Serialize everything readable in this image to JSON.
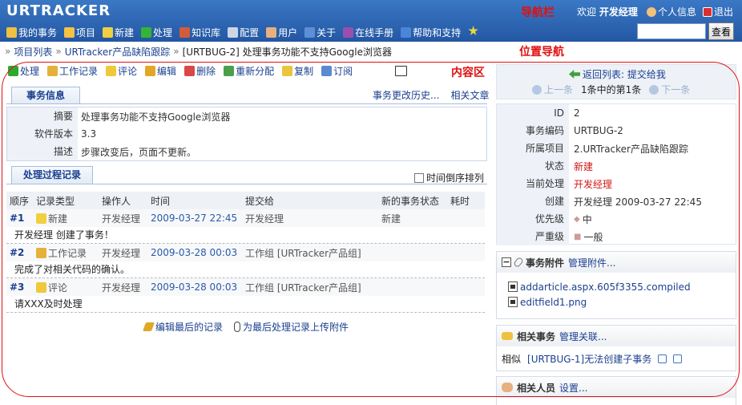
{
  "header": {
    "logo": "URTRACKER",
    "nav_annotation": "导航栏",
    "welcome_prefix": "欢迎",
    "user_name": "开发经理",
    "profile": "个人信息",
    "logout": "退出",
    "search_button": "查看",
    "search_value": ""
  },
  "menu": [
    {
      "label": "我的事务",
      "icon": "home-icon",
      "color": "#f0c040"
    },
    {
      "label": "项目",
      "icon": "database-icon",
      "color": "#f5c242"
    },
    {
      "label": "新建",
      "icon": "new-icon",
      "color": "#f0d040"
    },
    {
      "label": "处理",
      "icon": "check-icon",
      "color": "#34b534"
    },
    {
      "label": "知识库",
      "icon": "books-icon",
      "color": "#d35c3a"
    },
    {
      "label": "配置",
      "icon": "gear-icon",
      "color": "#cfd6e3"
    },
    {
      "label": "用户",
      "icon": "users-icon",
      "color": "#e6b080"
    },
    {
      "label": "关于",
      "icon": "info-icon",
      "color": "#5d8fd8"
    },
    {
      "label": "在线手册",
      "icon": "book-icon",
      "color": "#9a4fb0"
    },
    {
      "label": "帮助和支持",
      "icon": "help-icon",
      "color": "#4b86d6"
    }
  ],
  "breadcrumb": {
    "items": [
      "项目列表",
      "URTracker产品缺陷跟踪"
    ],
    "current": "[URTBUG-2] 处理事务功能不支持Google浏览器",
    "annotation": "位置导航"
  },
  "toolbar": {
    "items": [
      {
        "label": "处理",
        "icon": "check-icon",
        "color": "#2fa82f"
      },
      {
        "label": "工作记录",
        "icon": "notes-icon",
        "color": "#e5b13a"
      },
      {
        "label": "评论",
        "icon": "comment-icon",
        "color": "#f0c83c"
      },
      {
        "label": "编辑",
        "icon": "pencil-icon",
        "color": "#e0a826"
      },
      {
        "label": "删除",
        "icon": "delete-icon",
        "color": "#d94747"
      },
      {
        "label": "重新分配",
        "icon": "reassign-icon",
        "color": "#4aa04a"
      },
      {
        "label": "复制",
        "icon": "copy-icon",
        "color": "#e9c43e"
      },
      {
        "label": "订阅",
        "icon": "mail-icon",
        "color": "#5a8ad0"
      }
    ],
    "content_annotation": "内容区"
  },
  "tabs": {
    "info": "事务信息",
    "history": "事务更改历史...",
    "related": "相关文章",
    "records": "处理过程记录",
    "reverse": "时间倒序排列"
  },
  "info": [
    {
      "key": "摘要",
      "value": "处理事务功能不支持Google浏览器"
    },
    {
      "key": "软件版本",
      "value": "3.3"
    },
    {
      "key": "描述",
      "value": "步骤改变后，页面不更新。"
    }
  ],
  "records": {
    "columns": [
      "顺序",
      "记录类型",
      "操作人",
      "时间",
      "提交给",
      "新的事务状态",
      "耗时"
    ],
    "rows": [
      {
        "seq": "#1",
        "type": "新建",
        "icon": "new-icon",
        "color": "#f0d040",
        "operator": "开发经理",
        "time": "2009-03-27 22:45",
        "to": "开发经理",
        "status": "新建",
        "cost": "",
        "desc": "开发经理 创建了事务！"
      },
      {
        "seq": "#2",
        "type": "工作记录",
        "icon": "notes-icon",
        "color": "#e5b13a",
        "operator": "开发经理",
        "time": "2009-03-28 00:03",
        "to": "工作组 [URTracker产品组]",
        "status": "",
        "cost": "",
        "desc": "完成了对相关代码的确认。"
      },
      {
        "seq": "#3",
        "type": "评论",
        "icon": "comment-icon",
        "color": "#f0c83c",
        "operator": "开发经理",
        "time": "2009-03-28 00:03",
        "to": "工作组 [URTracker产品组]",
        "status": "",
        "cost": "",
        "desc": "请XXX及时处理"
      }
    ],
    "edit_last": "编辑最后的记录",
    "upload": "为最后处理记录上传附件"
  },
  "nav": {
    "back": "返回列表: 提交给我",
    "prev": "上一条",
    "position": "1条中的第1条",
    "next": "下一条"
  },
  "props": [
    {
      "key": "ID",
      "value": "2"
    },
    {
      "key": "事务编码",
      "value": "URTBUG-2"
    },
    {
      "key": "所属项目",
      "value": "2.URTracker产品缺陷跟踪"
    },
    {
      "key": "状态",
      "value": "新建",
      "red": true
    },
    {
      "key": "当前处理",
      "value": "开发经理",
      "red": true
    },
    {
      "key": "创建",
      "value": "开发经理  2009-03-27 22:45"
    },
    {
      "key": "优先级",
      "value": "中",
      "marker": "◆"
    },
    {
      "key": "严重级",
      "value": "一般",
      "marker": "■"
    }
  ],
  "attachments": {
    "title": "事务附件",
    "manage": "管理附件...",
    "files": [
      "addarticle.aspx.605f3355.compiled",
      "editfield1.png"
    ]
  },
  "related_issues": {
    "title": "相关事务",
    "manage": "管理关联...",
    "type": "相似",
    "item": "[URTBUG-1]无法创建子事务"
  },
  "related_people": {
    "title": "相关人员",
    "setting": "设置..."
  }
}
